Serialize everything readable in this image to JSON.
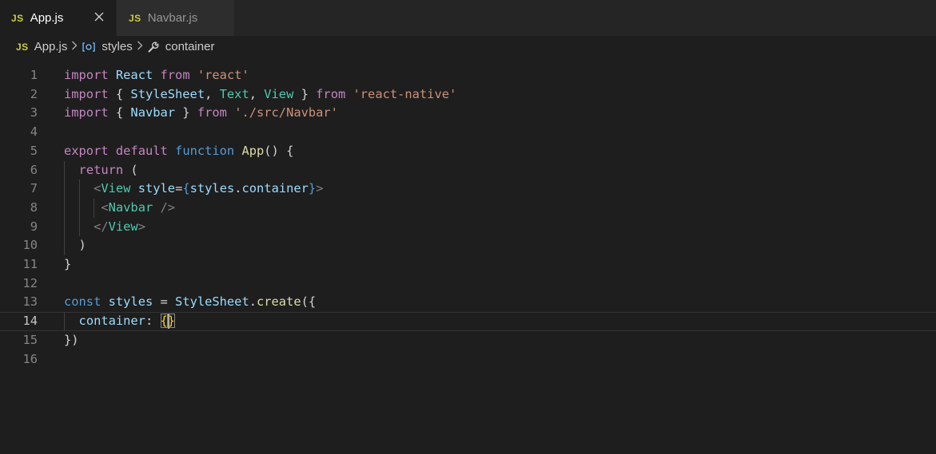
{
  "tabs": [
    {
      "badge": "JS",
      "label": "App.js",
      "active": true
    },
    {
      "badge": "JS",
      "label": "Navbar.js",
      "active": false
    }
  ],
  "breadcrumb": {
    "badge": "JS",
    "file": "App.js",
    "symbol": "styles",
    "property": "container"
  },
  "editor": {
    "line_numbers": [
      "1",
      "2",
      "3",
      "4",
      "5",
      "6",
      "7",
      "8",
      "9",
      "10",
      "11",
      "12",
      "13",
      "14",
      "15",
      "16"
    ],
    "current_line": 14,
    "lines": [
      "import React from 'react'",
      "import { StyleSheet, Text, View } from 'react-native'",
      "import { Navbar } from './src/Navbar'",
      "",
      "export default function App() {",
      "  return (",
      "    <View style={styles.container}>",
      "     <Navbar />",
      "    </View>",
      "  )",
      "}",
      "",
      "const styles = StyleSheet.create({",
      "  container: {}",
      "})",
      ""
    ]
  },
  "colors": {
    "editor_bg": "#1e1e1e",
    "keyword": "#c586c0",
    "storage": "#569cd6",
    "variable": "#9cdcfe",
    "type": "#4ec9b0",
    "string": "#ce9178",
    "function": "#dcdcaa",
    "js_badge": "#cbcb41"
  }
}
